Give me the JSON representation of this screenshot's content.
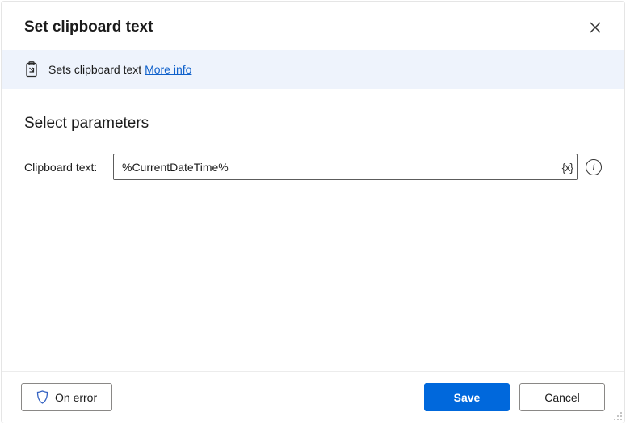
{
  "header": {
    "title": "Set clipboard text"
  },
  "banner": {
    "text": "Sets clipboard text",
    "more_info_label": "More info"
  },
  "section": {
    "title": "Select parameters"
  },
  "params": {
    "clipboard_text": {
      "label": "Clipboard text:",
      "value": "%CurrentDateTime%",
      "variable_button_label": "{x}",
      "help_label": "i"
    }
  },
  "footer": {
    "on_error_label": "On error",
    "save_label": "Save",
    "cancel_label": "Cancel"
  }
}
